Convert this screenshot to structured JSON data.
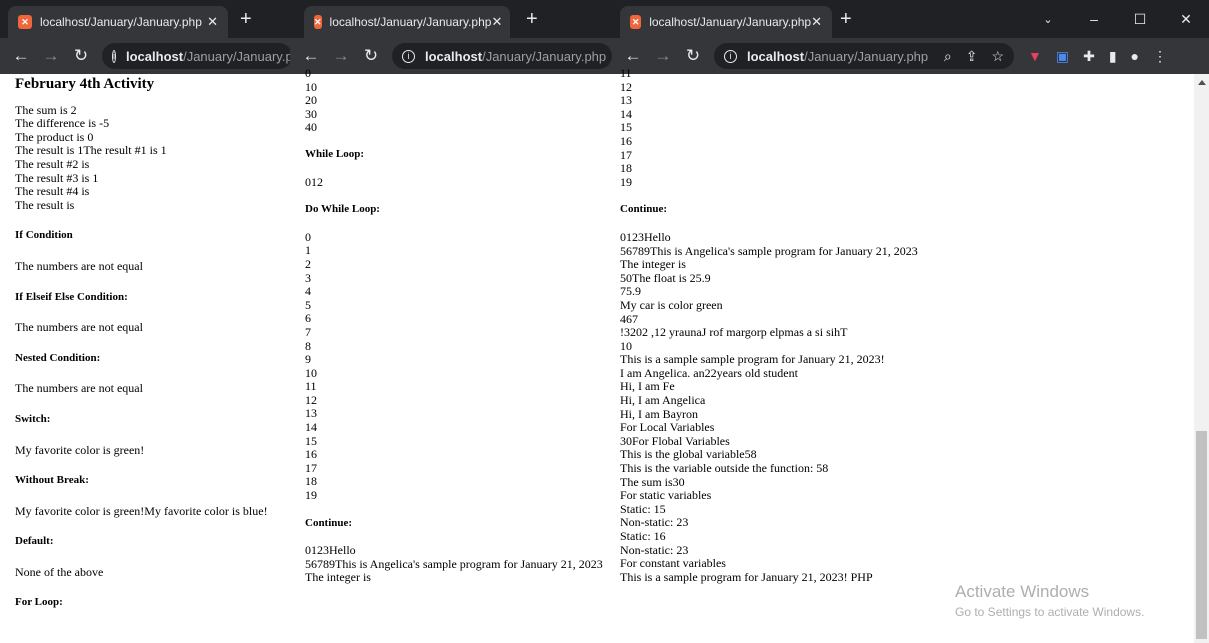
{
  "tab_title": "localhost/January/January.php",
  "url_host": "localhost",
  "url_path": "/January/January.php",
  "window1": {
    "title": "February 4th Activity",
    "lines": [
      "The sum is 2",
      "The difference is -5",
      "The product is 0",
      "The result is 1The result #1 is 1",
      "The result #2 is",
      "The result #3 is 1",
      "The result #4 is",
      "The result is"
    ],
    "sections": [
      {
        "heading": "If Condition",
        "text": "The numbers are not equal"
      },
      {
        "heading": "If Elseif Else Condition:",
        "text": "The numbers are not equal"
      },
      {
        "heading": "Nested Condition:",
        "text": "The numbers are not equal"
      },
      {
        "heading": "Switch:",
        "text": "My favorite color is green!"
      },
      {
        "heading": "Without Break:",
        "text": "My favorite color is green!My favorite color is blue!"
      },
      {
        "heading": "Default:",
        "text": "None of the above"
      },
      {
        "heading": "For Loop:",
        "text": ""
      }
    ]
  },
  "window2": {
    "top_lines": [
      "0",
      "10",
      "20",
      "30",
      "40"
    ],
    "while_heading": "While Loop:",
    "while_text": "012",
    "dowhile_heading": "Do While Loop:",
    "dowhile_lines": [
      "0",
      "1",
      "2",
      "3",
      "4",
      "5",
      "6",
      "7",
      "8",
      "9",
      "10",
      "11",
      "12",
      "13",
      "14",
      "15",
      "16",
      "17",
      "18",
      "19"
    ],
    "continue_heading": "Continue:",
    "continue_lines": [
      "0123Hello",
      "56789This is Angelica's sample program for January 21, 2023",
      "The integer is"
    ]
  },
  "window3": {
    "top_lines": [
      "11",
      "12",
      "13",
      "14",
      "15",
      "16",
      "17",
      "18",
      "19"
    ],
    "continue_heading": "Continue:",
    "continue_lines": [
      "0123Hello",
      "56789This is Angelica's sample program for January 21, 2023",
      "The integer is",
      "50The float is 25.9",
      "75.9",
      "My car is color green",
      "467",
      "!3202 ,12 yraunaJ rof margorp elpmas a si sihT",
      "10",
      "This is a sample sample program for January 21, 2023!",
      "I am Angelica. an22years old student",
      "Hi, I am Fe",
      "Hi, I am Angelica",
      "Hi, I am Bayron",
      "For Local Variables",
      "30For Flobal Variables",
      "This is the global variable58",
      "This is the variable outside the function: 58",
      "The sum is30",
      "For static variables",
      "Static: 15",
      "Non-static: 23",
      "Static: 16",
      "Non-static: 23",
      "For constant variables",
      "This is a sample program for January 21, 2023! PHP"
    ]
  },
  "watermark": {
    "title": "Activate Windows",
    "subtitle": "Go to Settings to activate Windows."
  }
}
